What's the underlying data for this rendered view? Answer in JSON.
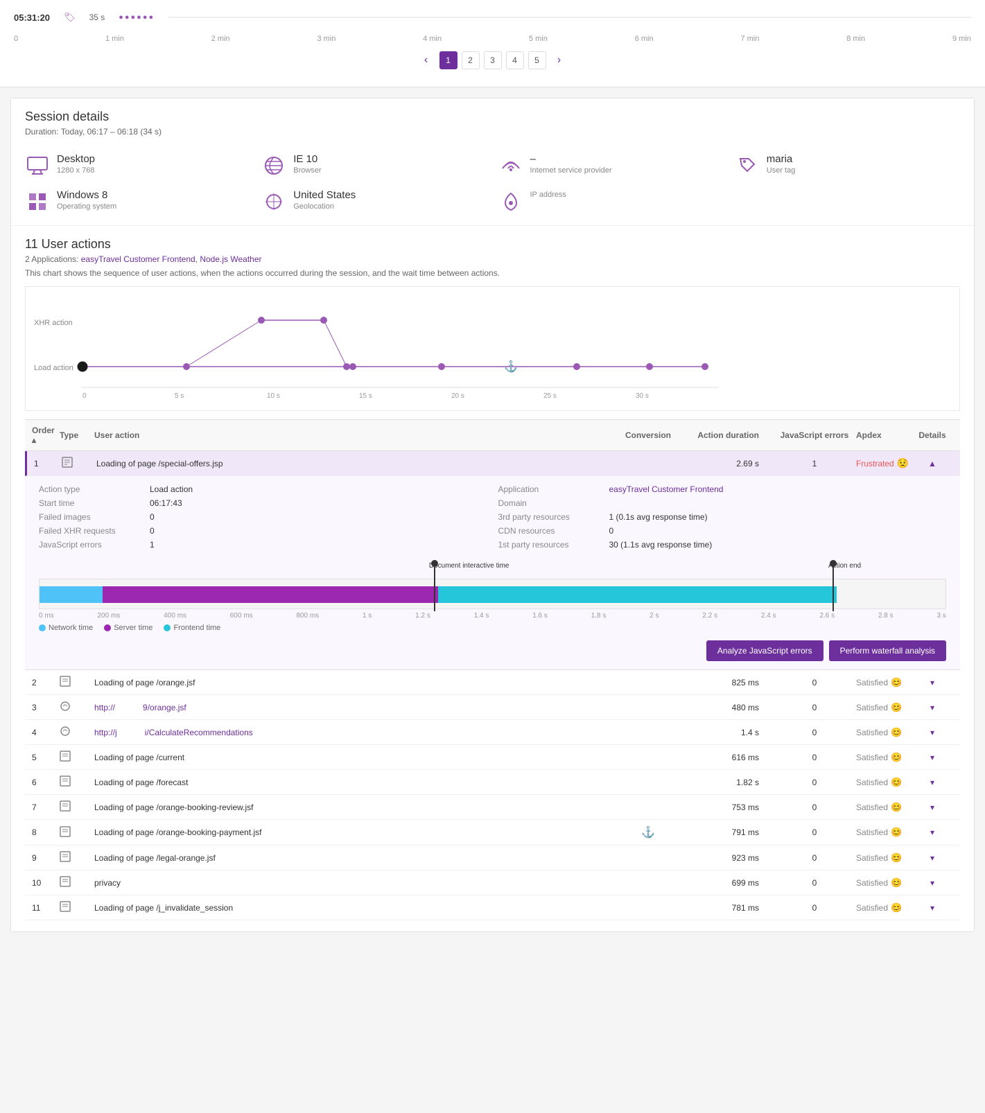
{
  "pagination": {
    "current": 1,
    "pages": [
      "1",
      "2",
      "3",
      "4",
      "5"
    ],
    "prev_label": "‹",
    "next_label": "›"
  },
  "timeline": {
    "start_time": "05:31:20",
    "duration": "35 s",
    "ruler": [
      "0",
      "1 min",
      "2 min",
      "3 min",
      "4 min",
      "5 min",
      "6 min",
      "7 min",
      "8 min",
      "9 min"
    ]
  },
  "session": {
    "title": "Session details",
    "duration_label": "Duration: Today, 06:17 – 06:18 (34 s)",
    "details": [
      {
        "icon": "desktop-icon",
        "value": "Desktop",
        "sub": "1280 x 768",
        "label": ""
      },
      {
        "icon": "browser-icon",
        "value": "IE 10",
        "sub": "Browser",
        "label": ""
      },
      {
        "icon": "isp-icon",
        "value": "–",
        "sub": "Internet service provider",
        "label": ""
      },
      {
        "icon": "tag-icon",
        "value": "maria",
        "sub": "User tag",
        "label": ""
      },
      {
        "icon": "os-icon",
        "value": "Windows 8",
        "sub": "Operating system",
        "label": ""
      },
      {
        "icon": "geo-icon",
        "value": "United States",
        "sub": "Geolocation",
        "label": ""
      },
      {
        "icon": "ip-icon",
        "value": "",
        "sub": "IP address",
        "label": ""
      }
    ]
  },
  "user_actions": {
    "title": "11 User actions",
    "apps_prefix": "2 Applications: ",
    "apps": [
      "easyTravel Customer Frontend",
      "Node.js Weather"
    ],
    "description": "This chart shows the sequence of user actions, when the actions occurred during the session, and the wait time between actions.",
    "chart_labels": {
      "xhr_action": "XHR action",
      "load_action": "Load action"
    },
    "ruler": [
      "0",
      "5 s",
      "10 s",
      "15 s",
      "20 s",
      "25 s",
      "30 s"
    ]
  },
  "table": {
    "headers": [
      "Order",
      "Type",
      "User action",
      "Conversion",
      "Action duration",
      "JavaScript errors",
      "Apdex",
      "Details"
    ],
    "rows": [
      {
        "num": 1,
        "type": "page",
        "action": "Loading of page /special-offers.jsp",
        "conversion": "",
        "duration": "2.69 s",
        "js_errors": "1",
        "apdex": "Frustrated",
        "expanded": true
      },
      {
        "num": 2,
        "type": "page",
        "action": "Loading of page /orange.jsf",
        "conversion": "",
        "duration": "825 ms",
        "js_errors": "0",
        "apdex": "Satisfied",
        "expanded": false
      },
      {
        "num": 3,
        "type": "xhr",
        "action": "http://",
        "action2": "9/orange.jsf",
        "conversion": "",
        "duration": "480 ms",
        "js_errors": "0",
        "apdex": "Satisfied",
        "expanded": false
      },
      {
        "num": 4,
        "type": "xhr",
        "action": "http://j",
        "action2": "i/CalculateRecommendations",
        "conversion": "",
        "duration": "1.4 s",
        "js_errors": "0",
        "apdex": "Satisfied",
        "expanded": false
      },
      {
        "num": 5,
        "type": "page",
        "action": "Loading of page /current",
        "conversion": "",
        "duration": "616 ms",
        "js_errors": "0",
        "apdex": "Satisfied",
        "expanded": false
      },
      {
        "num": 6,
        "type": "page",
        "action": "Loading of page /forecast",
        "conversion": "",
        "duration": "1.82 s",
        "js_errors": "0",
        "apdex": "Satisfied",
        "expanded": false
      },
      {
        "num": 7,
        "type": "page",
        "action": "Loading of page /orange-booking-review.jsf",
        "conversion": "",
        "duration": "753 ms",
        "js_errors": "0",
        "apdex": "Satisfied",
        "expanded": false
      },
      {
        "num": 8,
        "type": "page",
        "action": "Loading of page /orange-booking-payment.jsf",
        "conversion": "flag",
        "duration": "791 ms",
        "js_errors": "0",
        "apdex": "Satisfied",
        "expanded": false
      },
      {
        "num": 9,
        "type": "page",
        "action": "Loading of page /legal-orange.jsf",
        "conversion": "",
        "duration": "923 ms",
        "js_errors": "0",
        "apdex": "Satisfied",
        "expanded": false
      },
      {
        "num": 10,
        "type": "page",
        "action": "privacy",
        "conversion": "",
        "duration": "699 ms",
        "js_errors": "0",
        "apdex": "Satisfied",
        "expanded": false
      },
      {
        "num": 11,
        "type": "page",
        "action": "Loading of page /j_invalidate_session",
        "conversion": "",
        "duration": "781 ms",
        "js_errors": "0",
        "apdex": "Satisfied",
        "expanded": false
      }
    ]
  },
  "expanded_row": {
    "action_type": "Load action",
    "application": "easyTravel Customer Frontend",
    "start_time": "06:17:43",
    "domain": "",
    "failed_images": "0",
    "third_party_resources": "1 (0.1s avg response time)",
    "failed_xhr": "0",
    "cdn_resources": "0",
    "js_errors": "1",
    "first_party_resources": "30 (1.1s avg response time)",
    "doc_interactive_label": "Document interactive time",
    "action_end_label": "Action end",
    "buttons": {
      "analyze": "Analyze JavaScript errors",
      "waterfall": "Perform waterfall analysis"
    },
    "legend": {
      "network": "Network time",
      "server": "Server time",
      "frontend": "Frontend time"
    }
  }
}
